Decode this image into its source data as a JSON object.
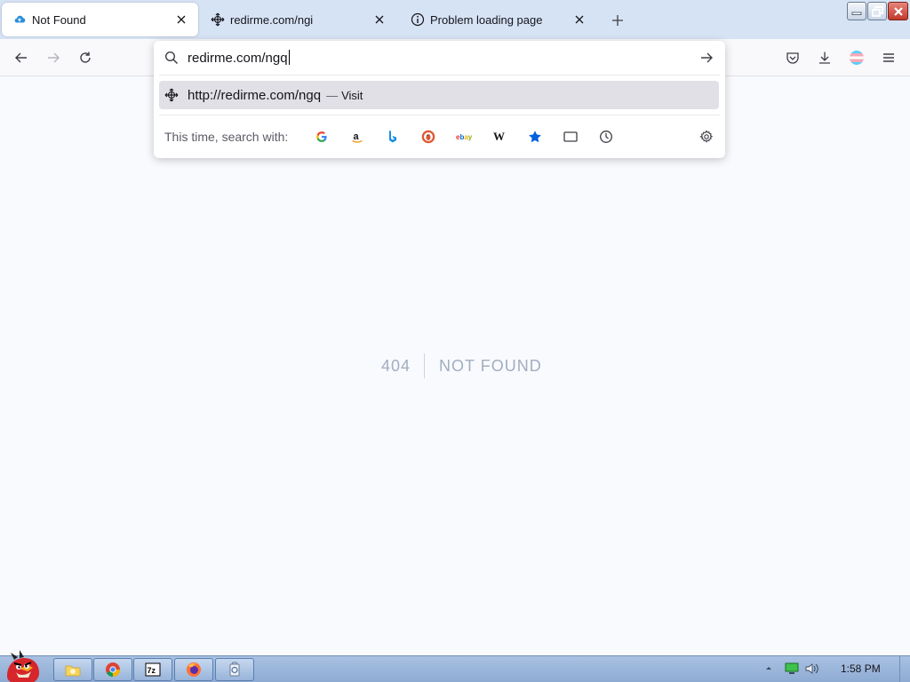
{
  "tabs": [
    {
      "title": "Not Found",
      "icon": "cloud-icon",
      "active": true
    },
    {
      "title": "redirme.com/ngi",
      "icon": "move-icon",
      "active": false
    },
    {
      "title": "Problem loading page",
      "icon": "info-icon",
      "active": false
    }
  ],
  "urlbar": {
    "value": "redirme.com/ngq",
    "suggestion_url": "http://redirme.com/ngq",
    "suggestion_separator": "—",
    "suggestion_action": "Visit",
    "search_with_label": "This time, search with:",
    "engines": [
      "google",
      "amazon",
      "bing",
      "duckduckgo",
      "ebay",
      "wikipedia",
      "bookmarks",
      "tabs",
      "history"
    ]
  },
  "page": {
    "code": "404",
    "message": "NOT FOUND"
  },
  "taskbar": {
    "clock": "1:58 PM"
  },
  "colors": {
    "tabstrip": "#d6e3f5",
    "content_bg": "#f8fafd",
    "notfound_text": "#a0aec0"
  }
}
